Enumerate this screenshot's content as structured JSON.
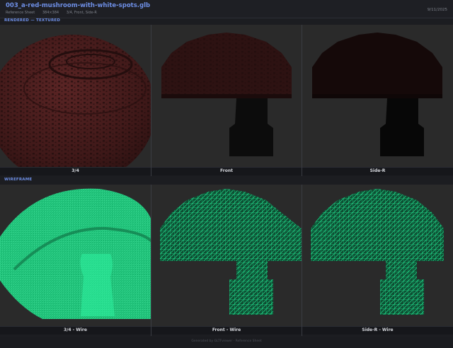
{
  "header": {
    "title": "003_a-red-mushroom-with-white-spots.glb",
    "subtitle_parts": [
      "Reference Sheet",
      "384×384",
      "3/4, Front, Side-R"
    ],
    "date": "9/11/2025"
  },
  "sections": {
    "rendered_label": "RENDERED — TEXTURED",
    "wireframe_label": "WIREFRAME"
  },
  "rendered_panels": [
    {
      "caption": "3/4"
    },
    {
      "caption": "Front"
    },
    {
      "caption": "Side-R"
    }
  ],
  "wire_panels": [
    {
      "caption": "3/4 - Wire"
    },
    {
      "caption": "Front - Wire"
    },
    {
      "caption": "Side-R - Wire"
    }
  ],
  "footer": {
    "text": "Generated by GLTFviewer · Reference Sheet"
  },
  "colors": {
    "accent": "#6e8fe6",
    "wire_green": "#19e38a",
    "mushroom_cap": "#4a1c1c",
    "panel_bg": "#2a2a2a"
  }
}
